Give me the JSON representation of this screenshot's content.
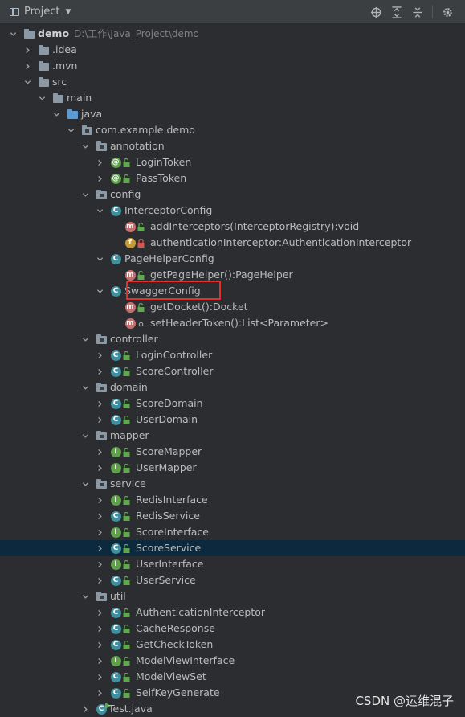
{
  "toolbar": {
    "title": "Project",
    "icons": [
      "locate-icon",
      "expand-all-icon",
      "collapse-all-icon",
      "gear-icon"
    ]
  },
  "tree": [
    {
      "label": "demo",
      "path": "D:\\工作\\Java_Project\\demo",
      "level": 0,
      "arrow": "down",
      "icon": "module",
      "root": true
    },
    {
      "label": ".idea",
      "level": 1,
      "arrow": "right",
      "icon": "folder"
    },
    {
      "label": ".mvn",
      "level": 1,
      "arrow": "right",
      "icon": "folder"
    },
    {
      "label": "src",
      "level": 1,
      "arrow": "down",
      "icon": "folder"
    },
    {
      "label": "main",
      "level": 2,
      "arrow": "down",
      "icon": "folder"
    },
    {
      "label": "java",
      "level": 3,
      "arrow": "down",
      "icon": "folder-blue"
    },
    {
      "label": "com.example.demo",
      "level": 4,
      "arrow": "down",
      "icon": "package"
    },
    {
      "label": "annotation",
      "level": 5,
      "arrow": "down",
      "icon": "package"
    },
    {
      "label": "LoginToken",
      "level": 6,
      "arrow": "right",
      "icon": "annotation",
      "vis": "unlocked"
    },
    {
      "label": "PassToken",
      "level": 6,
      "arrow": "right",
      "icon": "annotation",
      "vis": "unlocked"
    },
    {
      "label": "config",
      "level": 5,
      "arrow": "down",
      "icon": "package"
    },
    {
      "label": "InterceptorConfig",
      "level": 6,
      "arrow": "down",
      "icon": "class"
    },
    {
      "label": "addInterceptors(InterceptorRegistry):void",
      "level": 7,
      "arrow": "none",
      "icon": "method",
      "vis": "unlocked"
    },
    {
      "label": "authenticationInterceptor:AuthenticationInterceptor",
      "level": 7,
      "arrow": "none",
      "icon": "field",
      "vis": "locked"
    },
    {
      "label": "PageHelperConfig",
      "level": 6,
      "arrow": "down",
      "icon": "class"
    },
    {
      "label": "getPageHelper():PageHelper",
      "level": 7,
      "arrow": "none",
      "icon": "method",
      "vis": "unlocked"
    },
    {
      "label": "SwaggerConfig",
      "level": 6,
      "arrow": "down",
      "icon": "class"
    },
    {
      "label": "getDocket():Docket",
      "level": 7,
      "arrow": "none",
      "icon": "method",
      "vis": "unlocked"
    },
    {
      "label": "setHeaderToken():List<Parameter>",
      "level": 7,
      "arrow": "none",
      "icon": "method",
      "vis": "package"
    },
    {
      "label": "controller",
      "level": 5,
      "arrow": "down",
      "icon": "package"
    },
    {
      "label": "LoginController",
      "level": 6,
      "arrow": "right",
      "icon": "class",
      "vis": "unlocked"
    },
    {
      "label": "ScoreController",
      "level": 6,
      "arrow": "right",
      "icon": "class",
      "vis": "unlocked"
    },
    {
      "label": "domain",
      "level": 5,
      "arrow": "down",
      "icon": "package"
    },
    {
      "label": "ScoreDomain",
      "level": 6,
      "arrow": "right",
      "icon": "class",
      "vis": "unlocked"
    },
    {
      "label": "UserDomain",
      "level": 6,
      "arrow": "right",
      "icon": "class",
      "vis": "unlocked"
    },
    {
      "label": "mapper",
      "level": 5,
      "arrow": "down",
      "icon": "package"
    },
    {
      "label": "ScoreMapper",
      "level": 6,
      "arrow": "right",
      "icon": "interface",
      "vis": "unlocked"
    },
    {
      "label": "UserMapper",
      "level": 6,
      "arrow": "right",
      "icon": "interface",
      "vis": "unlocked"
    },
    {
      "label": "service",
      "level": 5,
      "arrow": "down",
      "icon": "package"
    },
    {
      "label": "RedisInterface",
      "level": 6,
      "arrow": "right",
      "icon": "interface",
      "vis": "unlocked"
    },
    {
      "label": "RedisService",
      "level": 6,
      "arrow": "right",
      "icon": "class",
      "vis": "unlocked"
    },
    {
      "label": "ScoreInterface",
      "level": 6,
      "arrow": "right",
      "icon": "interface",
      "vis": "unlocked"
    },
    {
      "label": "ScoreService",
      "level": 6,
      "arrow": "right",
      "icon": "class",
      "vis": "unlocked",
      "selected": true
    },
    {
      "label": "UserInterface",
      "level": 6,
      "arrow": "right",
      "icon": "interface",
      "vis": "unlocked"
    },
    {
      "label": "UserService",
      "level": 6,
      "arrow": "right",
      "icon": "class",
      "vis": "unlocked"
    },
    {
      "label": "util",
      "level": 5,
      "arrow": "down",
      "icon": "package"
    },
    {
      "label": "AuthenticationInterceptor",
      "level": 6,
      "arrow": "right",
      "icon": "class",
      "vis": "unlocked"
    },
    {
      "label": "CacheResponse",
      "level": 6,
      "arrow": "right",
      "icon": "class",
      "vis": "unlocked"
    },
    {
      "label": "GetCheckToken",
      "level": 6,
      "arrow": "right",
      "icon": "class",
      "vis": "unlocked"
    },
    {
      "label": "ModelViewInterface",
      "level": 6,
      "arrow": "right",
      "icon": "interface",
      "vis": "unlocked"
    },
    {
      "label": "ModelViewSet",
      "level": 6,
      "arrow": "right",
      "icon": "class",
      "vis": "unlocked"
    },
    {
      "label": "SelfKeyGenerate",
      "level": 6,
      "arrow": "right",
      "icon": "class",
      "vis": "unlocked"
    },
    {
      "label": "Test.java",
      "level": 5,
      "arrow": "right",
      "icon": "class-run"
    }
  ],
  "highlight": {
    "target": "SwaggerConfig",
    "color": "#e3302d"
  },
  "watermark": "CSDN @运维混子",
  "colors": {
    "background": "#2b2d30",
    "selected_row": "#0d293e",
    "class_badge": "#3f8f9e",
    "interface_badge": "#60a04c",
    "method_badge": "#c1716f",
    "field_badge": "#c69a3b",
    "folder": "#8c98a4",
    "source_folder": "#5b9bd5"
  }
}
